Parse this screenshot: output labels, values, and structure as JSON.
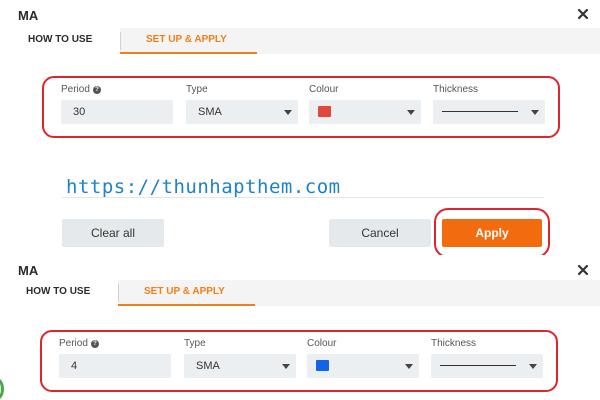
{
  "panels": [
    {
      "title": "MA",
      "tabs": {
        "how_to_use": "HOW TO USE",
        "setup_apply": "SET UP & APPLY"
      },
      "fields": {
        "period": {
          "label": "Period",
          "value": "30"
        },
        "type": {
          "label": "Type",
          "value": "SMA"
        },
        "colour": {
          "label": "Colour",
          "color": "#e0483a"
        },
        "thickness": {
          "label": "Thickness"
        }
      },
      "watermark": "https://thunhapthem.com",
      "buttons": {
        "clear_all": "Clear all",
        "cancel": "Cancel",
        "apply": "Apply"
      }
    },
    {
      "title": "MA",
      "tabs": {
        "how_to_use": "HOW TO USE",
        "setup_apply": "SET UP & APPLY"
      },
      "fields": {
        "period": {
          "label": "Period",
          "value": "4"
        },
        "type": {
          "label": "Type",
          "value": "SMA"
        },
        "colour": {
          "label": "Colour",
          "color": "#1463e6"
        },
        "thickness": {
          "label": "Thickness"
        }
      }
    }
  ],
  "icons": {
    "close": "close-icon",
    "info": "info-icon",
    "dropdown": "chevron-down-icon"
  },
  "colors": {
    "accent": "#f07f18",
    "apply_bg": "#f26b0f",
    "highlight": "#e0232d",
    "watermark": "#1d83c8"
  }
}
